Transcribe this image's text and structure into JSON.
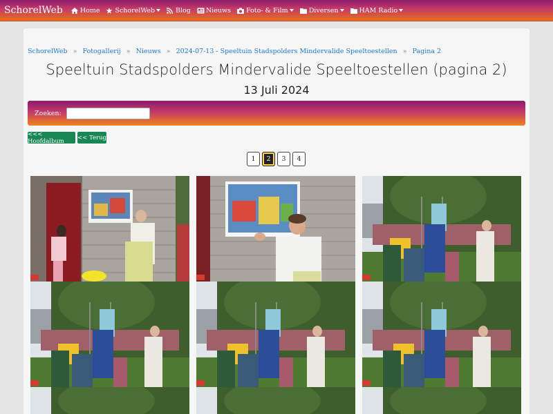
{
  "navbar": {
    "brand": "SchorelWeb",
    "items": [
      {
        "label": "Home",
        "icon": "home-icon"
      },
      {
        "label": "SchorelWeb",
        "icon": "star-icon",
        "dropdown": true
      },
      {
        "label": "Blog",
        "icon": "rss-icon"
      },
      {
        "label": "Nieuws",
        "icon": "newspaper-icon"
      },
      {
        "label": "Foto- & Film",
        "icon": "camera-icon",
        "dropdown": true
      },
      {
        "label": "Diversen",
        "icon": "folder-icon",
        "dropdown": true
      },
      {
        "label": "HAM Radio",
        "icon": "folder-icon",
        "dropdown": true
      }
    ]
  },
  "breadcrumb": {
    "items": [
      "SchorelWeb",
      "Fotogallerij",
      "Nieuws",
      "2024-07-13 - Speeltuin Stadspolders Mindervalide Speeltoestellen",
      "Pagina 2"
    ],
    "separator": "»"
  },
  "page": {
    "title": "Speeltuin Stadspolders Mindervalide Speeltoestellen (pagina 2)",
    "date": "13 Juli 2024"
  },
  "search": {
    "label": "Zoeken:",
    "value": ""
  },
  "buttons": {
    "main_album": "<<< Hoofdalbum",
    "back": "<< Terug"
  },
  "pagination": {
    "pages": [
      "1",
      "2",
      "3",
      "4"
    ],
    "current": "2"
  },
  "gallery": {
    "photos": [
      "wall-mural-girl-woman",
      "woman-pointing-mural",
      "playground-crowd",
      "playground-crowd",
      "playground-crowd",
      "playground-crowd",
      "trees-partial",
      "trees-partial",
      "trees-partial"
    ]
  },
  "colors": {
    "accent_green": "#198754",
    "link_blue": "#1d7bd6",
    "gradient_top": "#8c1d6e",
    "gradient_bottom": "#f0851a"
  }
}
